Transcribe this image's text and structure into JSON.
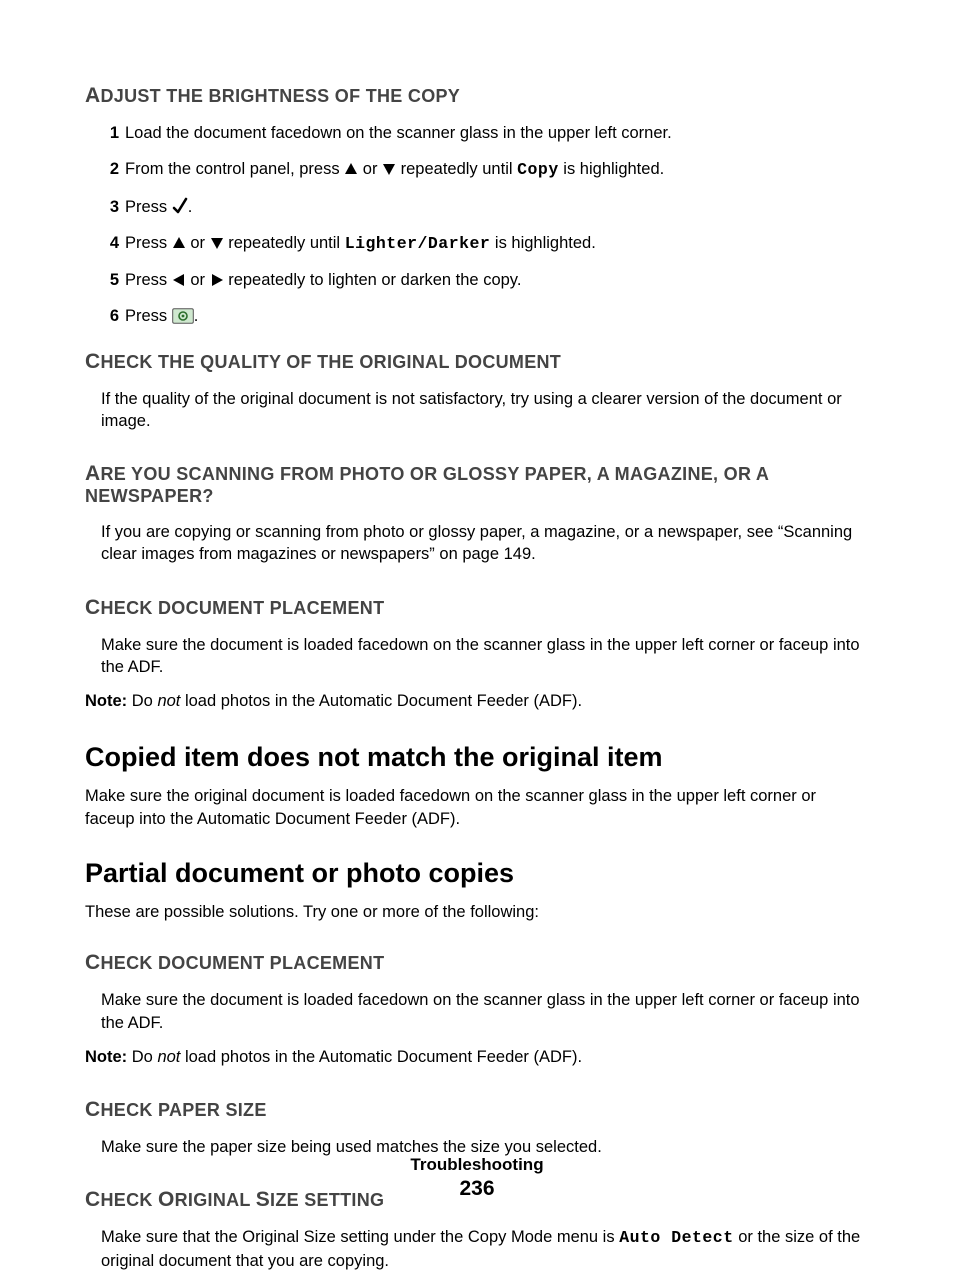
{
  "footer": {
    "section": "Troubleshooting",
    "page": "236"
  },
  "s1": {
    "heading_lead": "A",
    "heading_rest": "DJUST THE BRIGHTNESS OF THE COPY",
    "step1": "Load the document facedown on the scanner glass in the upper left corner.",
    "step2_a": "From the control panel, press ",
    "step2_b": " or ",
    "step2_c": " repeatedly until ",
    "step2_mono": "Copy",
    "step2_d": " is highlighted.",
    "step3_a": "Press ",
    "step3_b": ".",
    "step4_a": "Press ",
    "step4_b": " or ",
    "step4_c": " repeatedly until ",
    "step4_mono": "Lighter/Darker",
    "step4_d": " is highlighted.",
    "step5_a": "Press ",
    "step5_b": " or ",
    "step5_c": " repeatedly to lighten or darken the copy.",
    "step6_a": "Press ",
    "step6_b": "."
  },
  "s2": {
    "heading_lead": "C",
    "heading_rest": "HECK THE QUALITY OF THE ORIGINAL DOCUMENT",
    "body": "If the quality of the original document is not satisfactory, try using a clearer version of the document or image."
  },
  "s3": {
    "heading_lead": "A",
    "heading_rest": "RE YOU SCANNING FROM PHOTO OR GLOSSY PAPER, A MAGAZINE, OR A NEWSPAPER?",
    "body": "If you are copying or scanning from photo or glossy paper, a magazine, or a newspaper, see “Scanning clear images from magazines or newspapers” on page 149."
  },
  "s4": {
    "heading_lead": "C",
    "heading_rest": "HECK DOCUMENT PLACEMENT",
    "body": "Make sure the document is loaded facedown on the scanner glass in the upper left corner or faceup into the ADF.",
    "note_label": "Note:",
    "note_a": " Do ",
    "note_em": "not",
    "note_b": " load photos in the Automatic Document Feeder (ADF)."
  },
  "h2a": {
    "title": "Copied item does not match the original item",
    "body": "Make sure the original document is loaded facedown on the scanner glass in the upper left corner or faceup into the Automatic Document Feeder (ADF)."
  },
  "h2b": {
    "title": "Partial document or photo copies",
    "body": "These are possible solutions. Try one or more of the following:"
  },
  "s5": {
    "heading_lead": "C",
    "heading_rest": "HECK DOCUMENT PLACEMENT",
    "body": "Make sure the document is loaded facedown on the scanner glass in the upper left corner or faceup into the ADF.",
    "note_label": "Note:",
    "note_a": " Do ",
    "note_em": "not",
    "note_b": " load photos in the Automatic Document Feeder (ADF)."
  },
  "s6": {
    "heading_lead": "C",
    "heading_rest": "HECK PAPER SIZE",
    "body": "Make sure the paper size being used matches the size you selected."
  },
  "s7": {
    "heading_lead1": "C",
    "heading_rest1": "HECK ",
    "heading_lead2": "O",
    "heading_rest2": "RIGINAL ",
    "heading_lead3": "S",
    "heading_rest3": "IZE SETTING",
    "body_a": "Make sure that the Original Size setting under the Copy Mode menu is ",
    "body_mono": "Auto Detect",
    "body_b": " or the size of the original document that you are copying."
  }
}
